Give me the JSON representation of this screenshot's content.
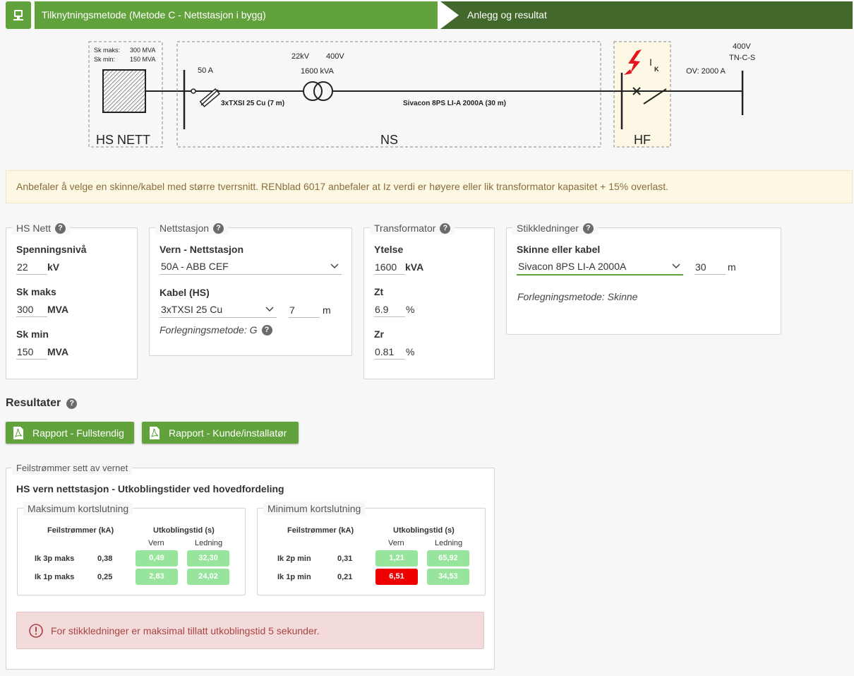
{
  "wizard": {
    "step1_label": "Tilknytningsmetode (Metode C - Nettstasjon i bygg)",
    "step2_label": "Anlegg og resultat"
  },
  "diagram": {
    "hs_sk_maks_label": "Sk maks:",
    "hs_sk_maks_value": "300 MVA",
    "hs_sk_min_label": "Sk min:",
    "hs_sk_min_value": "150 MVA",
    "hs_box_label": "HS NETT",
    "fuse_rating": "50 A",
    "cable_hs": "3xTXSI 25 Cu (7 m)",
    "voltage_primary": "22kV",
    "voltage_secondary": "400V",
    "transformer_rating": "1600 kVA",
    "busbar": "Sivacon 8PS LI-A 2000A (30 m)",
    "ns_box_label": "NS",
    "ik_letter": "I",
    "ik_sub": "K",
    "hf_box_label": "HF",
    "ov_label": "OV: 2000 A",
    "right_voltage": "400V",
    "right_system": "TN-C-S"
  },
  "warning_text": "Anbefaler å velge en skinne/kabel med større tverrsnitt. RENblad 6017 anbefaler at Iz verdi er høyere eller lik transformator kapasitet + 15% overlast.",
  "hs_nett": {
    "legend": "HS Nett",
    "spenning_label": "Spenningsnivå",
    "spenning_value": "22",
    "spenning_unit": "kV",
    "skmaks_label": "Sk maks",
    "skmaks_value": "300",
    "skmaks_unit": "MVA",
    "skmin_label": "Sk min",
    "skmin_value": "150",
    "skmin_unit": "MVA"
  },
  "nettstasjon": {
    "legend": "Nettstasjon",
    "vern_label": "Vern - Nettstasjon",
    "vern_value": "50A - ABB CEF",
    "kabel_label": "Kabel (HS)",
    "kabel_value": "3xTXSI 25 Cu",
    "kabel_length": "7",
    "kabel_unit": "m",
    "forlegning": "Forlegningsmetode: G"
  },
  "transformator": {
    "legend": "Transformator",
    "ytelse_label": "Ytelse",
    "ytelse_value": "1600",
    "ytelse_unit": "kVA",
    "zt_label": "Zt",
    "zt_value": "6.9",
    "zt_unit": "%",
    "zr_label": "Zr",
    "zr_value": "0.81",
    "zr_unit": "%"
  },
  "stikkledninger": {
    "legend": "Stikkledninger",
    "skinne_label": "Skinne eller kabel",
    "skinne_value": "Sivacon 8PS LI-A 2000A",
    "length_value": "30",
    "length_unit": "m",
    "forlegning": "Forlegningsmetode: Skinne"
  },
  "resultater": {
    "title": "Resultater",
    "btn_full": "Rapport - Fullstendig",
    "btn_kunde": "Rapport - Kunde/installatør",
    "fault_legend": "Feilstrømmer sett av vernet",
    "fault_heading": "HS vern nettstasjon - Utkoblingstider ved hovedfordeling",
    "col_feil": "Feilstrømmer (kA)",
    "col_utkobling": "Utkoblingstid (s)",
    "col_vern": "Vern",
    "col_ledning": "Ledning",
    "max": {
      "legend": "Maksimum kortslutning",
      "rows": [
        {
          "label": "Ik 3p maks",
          "ka": "0,38",
          "vern": "0,49",
          "ledning": "32,30"
        },
        {
          "label": "Ik 1p maks",
          "ka": "0,25",
          "vern": "2,83",
          "ledning": "24,02"
        }
      ]
    },
    "min": {
      "legend": "Minimum kortslutning",
      "rows": [
        {
          "label": "Ik 2p min",
          "ka": "0,31",
          "vern": "1,21",
          "ledning": "65,92"
        },
        {
          "label": "Ik 1p min",
          "ka": "0,21",
          "vern": "6,51",
          "ledning": "34,53"
        }
      ]
    },
    "error_text": "For stikkledninger er maksimal tillatt utkoblingstid 5 sekunder.",
    "colors": {
      "ok": "#97e59c",
      "bad": "#ee0000"
    }
  },
  "colors": {
    "primary": "#62a23c",
    "primary_dark": "#42692b",
    "warning_bg": "#fcf8e3",
    "error_bg": "#f3dbdc"
  },
  "icons": {
    "home": "monitor-icon",
    "pdf": "pdf-icon",
    "help": "question-circle-icon",
    "error": "exclamation-circle-icon",
    "chevron": "chevron-down-icon"
  }
}
